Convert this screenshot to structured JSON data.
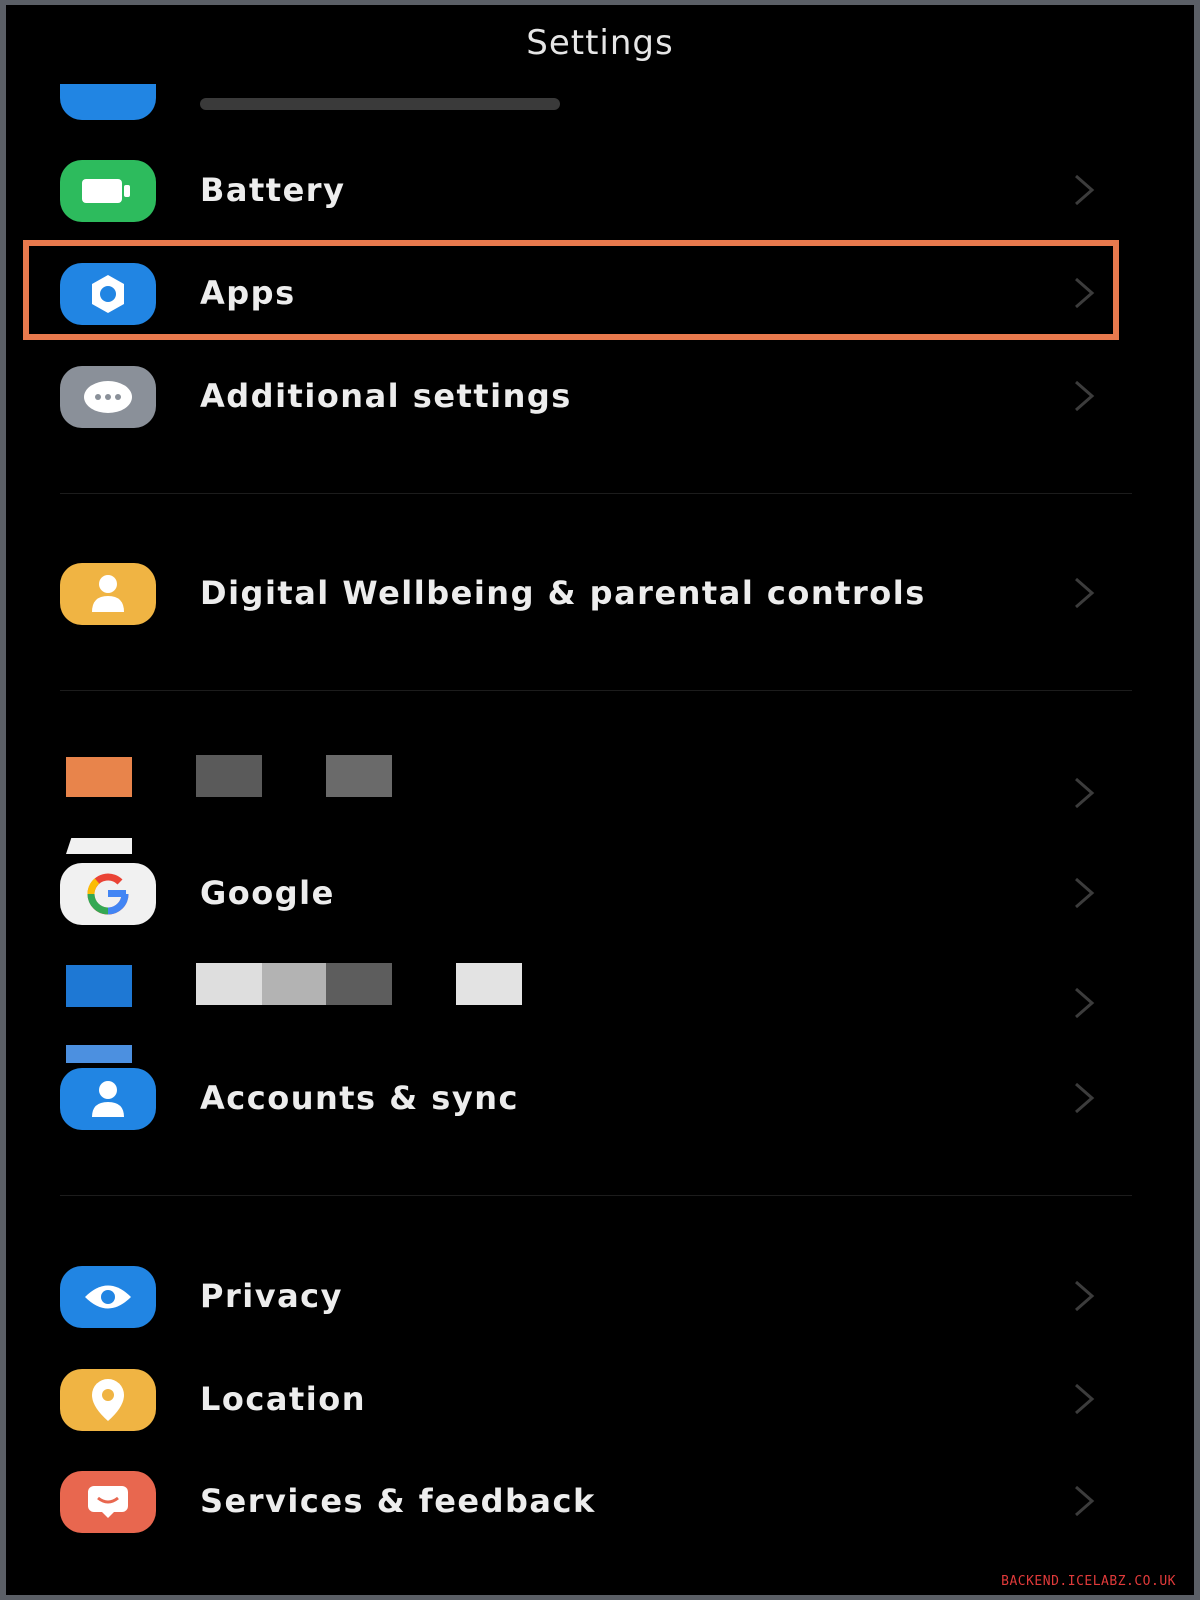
{
  "header": {
    "title": "Settings"
  },
  "colors": {
    "background": "#000000",
    "highlight": "#e8794d",
    "battery_icon": "#2dbb5d",
    "apps_icon": "#2185e3",
    "additional_icon": "#8a9099",
    "wellbeing_icon": "#f0b443",
    "accounts_icon": "#2185e3",
    "privacy_icon": "#2185e3",
    "location_icon": "#f0b443",
    "services_icon": "#e8674f"
  },
  "items": [
    {
      "id": "privacy-protection",
      "label": "",
      "icon": "shield-icon",
      "partially_hidden": true
    },
    {
      "id": "battery",
      "label": "Battery",
      "icon": "battery-icon"
    },
    {
      "id": "apps",
      "label": "Apps",
      "icon": "gear-icon",
      "highlighted": true
    },
    {
      "id": "additional-settings",
      "label": "Additional settings",
      "icon": "more-dots-icon"
    },
    {
      "id": "digital-wellbeing",
      "label": "Digital Wellbeing & parental controls",
      "icon": "person-icon"
    },
    {
      "id": "redacted-1",
      "label": "",
      "icon": "redacted-icon",
      "redacted": true
    },
    {
      "id": "google",
      "label": "Google",
      "icon": "google-g-icon"
    },
    {
      "id": "redacted-2",
      "label": "",
      "icon": "redacted-icon",
      "redacted": true
    },
    {
      "id": "accounts-sync",
      "label": "Accounts & sync",
      "icon": "account-icon"
    },
    {
      "id": "privacy",
      "label": "Privacy",
      "icon": "eye-icon"
    },
    {
      "id": "location",
      "label": "Location",
      "icon": "location-pin-icon"
    },
    {
      "id": "services-feedback",
      "label": "Services & feedback",
      "icon": "message-icon"
    }
  ],
  "watermark": "BACKEND.ICELABZ.CO.UK"
}
